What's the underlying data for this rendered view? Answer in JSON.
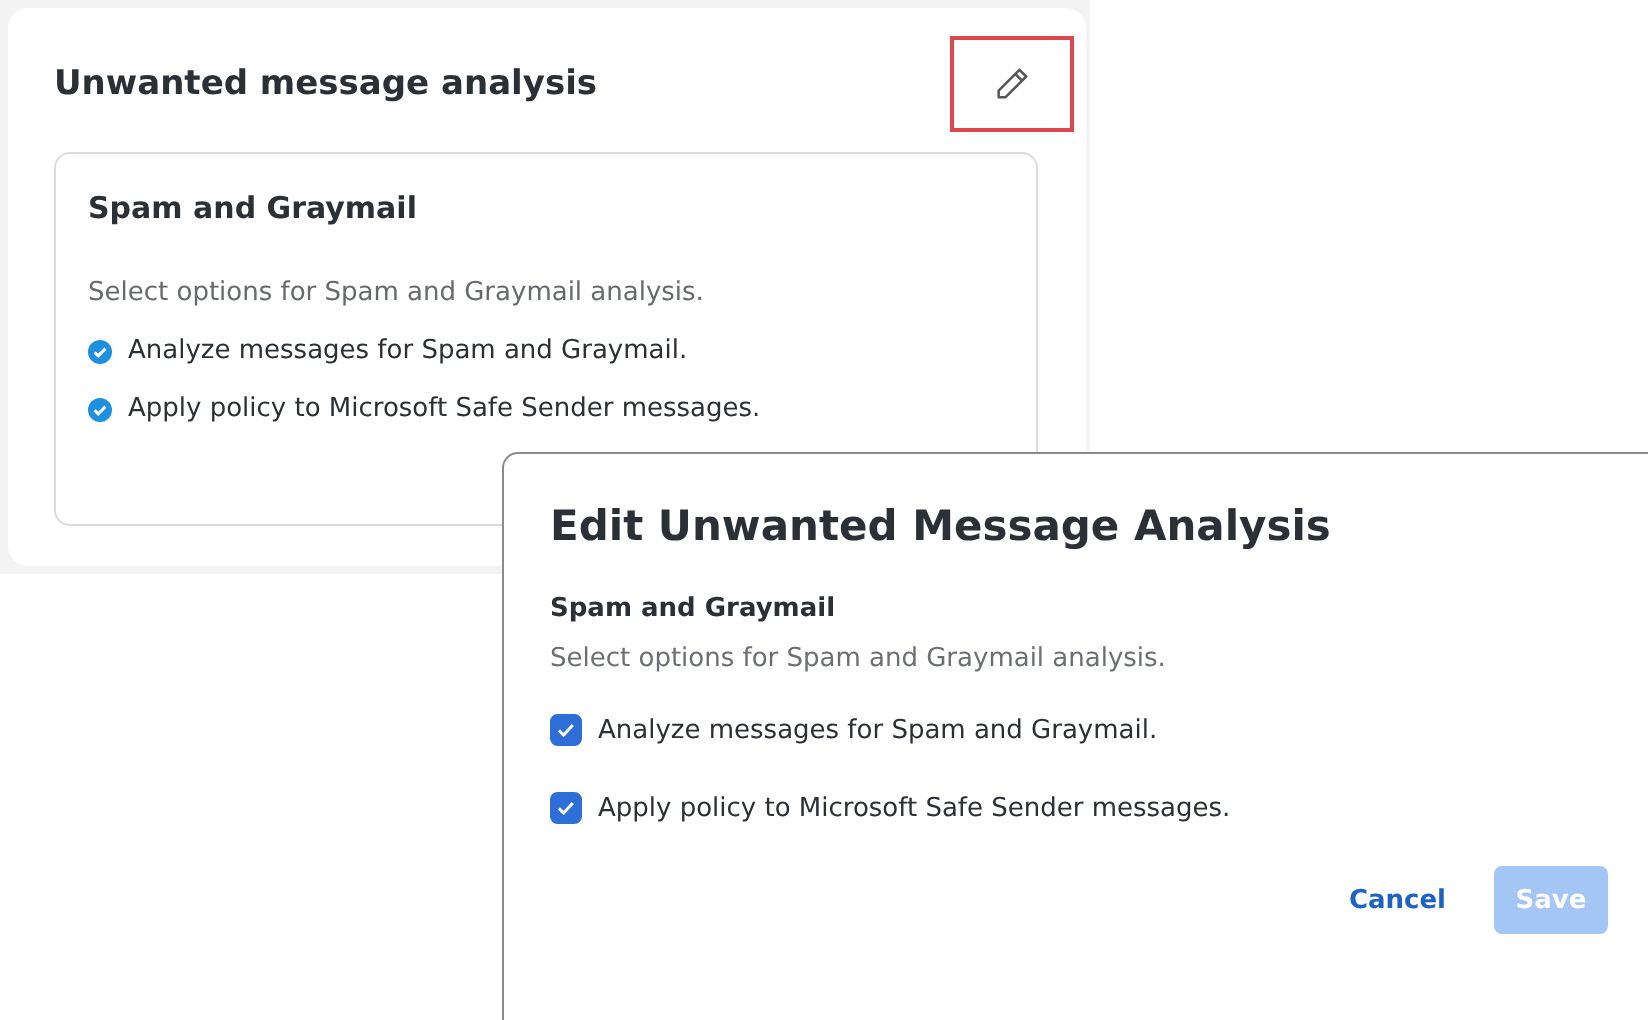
{
  "card": {
    "title": "Unwanted message analysis",
    "edit_button": {
      "highlighted": true
    },
    "section": {
      "title": "Spam and Graymail",
      "description": "Select options for Spam and Graymail analysis.",
      "items": [
        {
          "label": "Analyze messages for Spam and Graymail.",
          "enabled": true
        },
        {
          "label": "Apply policy to Microsoft Safe Sender messages.",
          "enabled": true
        }
      ]
    }
  },
  "dialog": {
    "title": "Edit Unwanted Message Analysis",
    "section_title": "Spam and Graymail",
    "description": "Select options for Spam and Graymail analysis.",
    "options": [
      {
        "label": "Analyze messages for Spam and Graymail.",
        "checked": true
      },
      {
        "label": "Apply policy to Microsoft Safe Sender messages.",
        "checked": true
      }
    ],
    "cancel": "Cancel",
    "save": {
      "label": "Save",
      "disabled": true
    }
  }
}
